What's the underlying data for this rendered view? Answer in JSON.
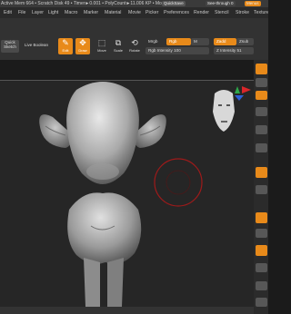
{
  "status_bar": {
    "text": "Active Mem 664 • Scratch Disk 49 • Timer►0.001 • PolyCount►11.006 KP • Mo",
    "quicksave": "QuickSave",
    "see_through": "See-through 0",
    "menu_button": "Menus"
  },
  "menubar": {
    "items": [
      "Edit",
      "File",
      "Layer",
      "Light",
      "Macro",
      "Marker",
      "Material",
      "Movie",
      "Picker",
      "Preferences",
      "Render",
      "Stencil",
      "Stroke",
      "Texture"
    ]
  },
  "toolbar": {
    "quick_sketch": "Quick Sketch",
    "live_boolean": "Live Boolean",
    "edit": "Edit",
    "draw": "Draw",
    "move": "Move",
    "scale": "Scale",
    "rotate": "Rotate",
    "mrgb": "Mrgb",
    "rgb": "Rgb",
    "m": "M",
    "rgb_intensity": "Rgb Intensity 100",
    "zadd": "Zadd",
    "zsub": "Zsub",
    "z_intensity": "Z Intensity 51"
  },
  "colors": {
    "accent": "#e88a1a",
    "background": "#1b1b1b",
    "viewport": "#262626",
    "brush_circle": "#9e1a1a",
    "gizmo_x": "#d9262a",
    "gizmo_y": "#2ea84a",
    "gizmo_z": "#2d5fd6"
  },
  "icons": [
    "edit-icon",
    "draw-icon",
    "move-icon",
    "scale-icon",
    "rotate-icon",
    "gizmo-icon",
    "head-preview-icon",
    "brush-cursor-icon"
  ]
}
